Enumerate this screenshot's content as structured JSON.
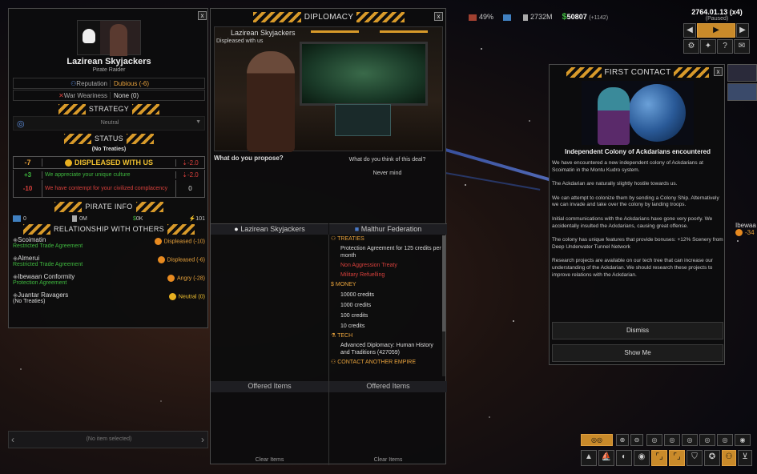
{
  "topbar": {
    "approval": "49%",
    "population": "2732M",
    "credits": "50807",
    "credits_delta": "(+1142)",
    "date": "2764.01.13 (x4)",
    "paused": "(Paused)"
  },
  "empire_panel": {
    "name": "Lazirean Skyjackers",
    "subtitle": "Pirate Raider",
    "reputation_label": "Reputation",
    "reputation_value": "Dubious (-6)",
    "war_label": "War Weariness",
    "war_value": "None (0)",
    "strategy_title": "STRATEGY",
    "strategy_value": "Neutral",
    "status_title": "STATUS",
    "status_treaties": "(No Treaties)",
    "status_score": "-7",
    "status_mood": "DISPLEASED WITH US",
    "status_mood_score": "-2.0",
    "reasons": [
      {
        "score": "+3",
        "text": "We appreciate your unique culture",
        "val": "-2.0"
      },
      {
        "score": "-10",
        "text": "We have contempt for your civilized complacency",
        "val": "0"
      }
    ],
    "pirate_title": "PIRATE INFO",
    "pirate_stats": [
      "0",
      "0M",
      "0K",
      "101"
    ],
    "relations_title": "RELATIONSHIP WITH OTHERS",
    "relations": [
      {
        "name": "Scoimatin",
        "treaty": "Restricted Trade Agreement",
        "mood": "Displeased (-10)"
      },
      {
        "name": "Almerui",
        "treaty": "Restricted Trade Agreement",
        "mood": "Displeased (-6)"
      },
      {
        "name": "Ibewaan Conformity",
        "treaty": "Protection Agreement",
        "mood": "Angry (-28)"
      },
      {
        "name": "Juantar Ravagers",
        "treaty": "(No Treaties)",
        "mood": "Neutral (0)"
      }
    ],
    "no_item": "(No item selected)"
  },
  "diplomacy": {
    "title": "DIPLOMACY",
    "leader_name": "Lazirean Skyjackers",
    "leader_mood": "Displeased with us",
    "propose": "What do you propose?",
    "think": "What do you think of this deal?",
    "response": "Never mind",
    "left_empire": "Lazirean Skyjackers",
    "right_empire": "Malthur Federation",
    "treaties_header": "TREATIES",
    "treaties": [
      {
        "text": "Protection Agreement for 125 credits per month",
        "color": "#d8d8d8"
      },
      {
        "text": "Non Aggression Treaty",
        "color": "#d8403c"
      },
      {
        "text": "Military Refuelling",
        "color": "#d8403c"
      }
    ],
    "money_header": "MONEY",
    "money": [
      "10000 credits",
      "1000 credits",
      "100 credits",
      "10 credits"
    ],
    "tech_header": "TECH",
    "tech": [
      "Advanced Diplomacy: Human History and Traditions (427059)"
    ],
    "contact_header": "CONTACT ANOTHER EMPIRE",
    "offered_left": "Offered Items",
    "offered_right": "Offered Items",
    "clear_left": "Clear Items",
    "clear_right": "Clear Items"
  },
  "first_contact": {
    "title": "FIRST CONTACT",
    "heading": "Independent Colony of Ackdarians encountered",
    "paragraphs": [
      "We have encountered a new independent colony of Ackdarians at Scoimatin in the Montu Kudro system.",
      "The Ackdarian are naturally slightly hostile towards us.",
      "We can attempt to colonize them by sending a Colony Ship. Alternatively we can invade and take over the colony by landing troops.",
      "Initial communications with the Ackdarians have gone very poorly. We accidentally insulted the Ackdarians, causing great offense.",
      "The colony has unique features that provide bonuses: +12% Scenery from Deep Underwater Tunnel Network",
      "Research projects are available on our tech tree that can increase our understanding of the Ackdarian. We should research these projects to improve relations with the Ackdarian."
    ],
    "dismiss": "Dismiss",
    "show_me": "Show Me"
  },
  "map": {
    "label_name": "Ibewaa",
    "label_val": "-34"
  },
  "colors": {
    "accent": "#d89a2a",
    "green": "#3fb83f",
    "red": "#d8403c"
  }
}
